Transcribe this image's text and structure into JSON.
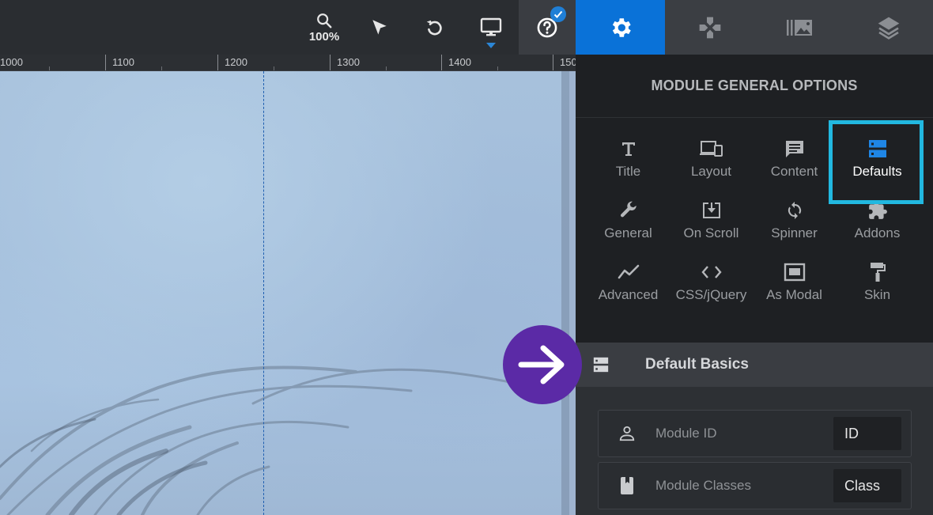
{
  "toolbar": {
    "zoom_label": "100%",
    "zoom_icon": "search-icon",
    "select_icon": "cursor-arrow-icon",
    "undo_icon": "undo-icon",
    "device_icon": "desktop-monitor-icon",
    "help_icon": "question-circle-icon"
  },
  "ruler": {
    "labels": [
      "1000",
      "1100",
      "1200",
      "1300",
      "1400",
      "150"
    ]
  },
  "panel_tabs": [
    {
      "name": "settings",
      "icon": "gear-icon",
      "active": true
    },
    {
      "name": "controls",
      "icon": "gamepad-icon",
      "active": false
    },
    {
      "name": "slides",
      "icon": "image-library-icon",
      "active": false
    },
    {
      "name": "layers",
      "icon": "layers-icon",
      "active": false
    }
  ],
  "panel": {
    "title": "MODULE GENERAL OPTIONS",
    "options": [
      {
        "label": "Title",
        "icon": "text-t-icon"
      },
      {
        "label": "Layout",
        "icon": "devices-icon"
      },
      {
        "label": "Content",
        "icon": "comment-icon"
      },
      {
        "label": "Defaults",
        "icon": "server-icon",
        "active": true
      },
      {
        "label": "General",
        "icon": "wrench-icon"
      },
      {
        "label": "On Scroll",
        "icon": "download-box-icon"
      },
      {
        "label": "Spinner",
        "icon": "sync-icon"
      },
      {
        "label": "Addons",
        "icon": "puzzle-icon"
      },
      {
        "label": "Advanced",
        "icon": "trend-line-icon"
      },
      {
        "label": "CSS/jQuery",
        "icon": "code-icon"
      },
      {
        "label": "As Modal",
        "icon": "modal-window-icon"
      },
      {
        "label": "Skin",
        "icon": "paint-roller-icon"
      }
    ],
    "section": {
      "title": "Default Basics",
      "icon": "server-icon",
      "fields": [
        {
          "label": "Module ID",
          "value": "ID",
          "icon": "person-icon"
        },
        {
          "label": "Module Classes",
          "value": "Class",
          "icon": "bookmark-icon"
        }
      ]
    }
  },
  "colors": {
    "accent_blue": "#0a72d8",
    "highlight_cyan": "#22b8e0",
    "arrow_badge_purple": "#5b2aa6"
  }
}
